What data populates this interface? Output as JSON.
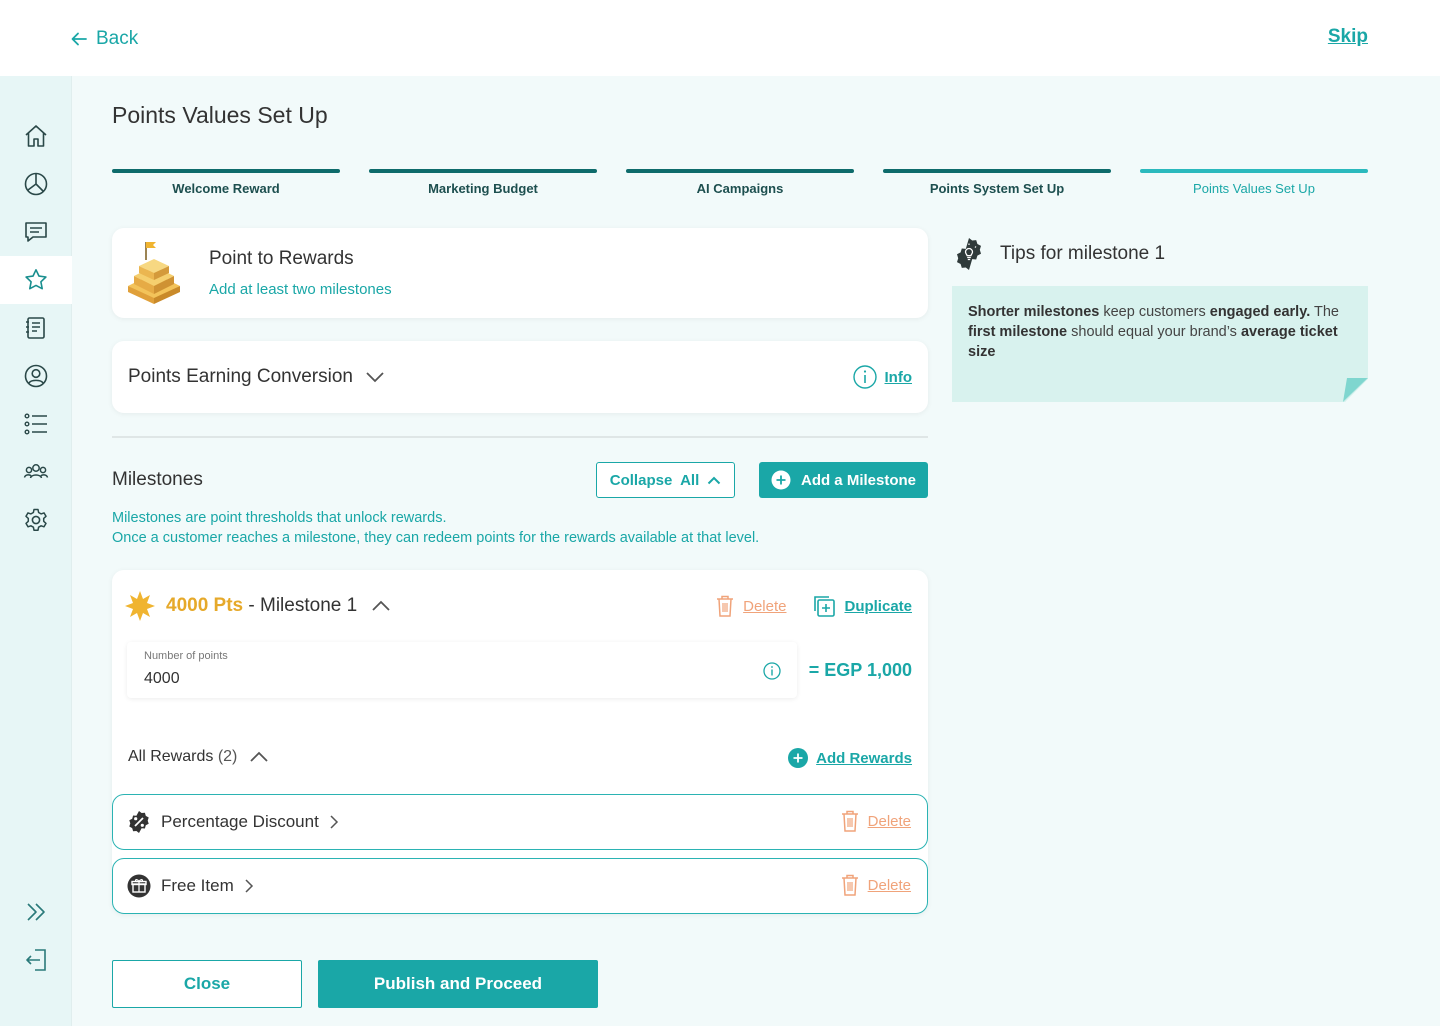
{
  "header": {
    "back_label": "Back",
    "skip_label": "Skip"
  },
  "sidebar": {
    "items": [
      {
        "icon": "home-icon"
      },
      {
        "icon": "chart-pie-icon"
      },
      {
        "icon": "chat-icon"
      },
      {
        "icon": "star-icon",
        "active": true
      },
      {
        "icon": "notebook-icon"
      },
      {
        "icon": "user-circle-icon"
      },
      {
        "icon": "list-icon"
      },
      {
        "icon": "group-icon"
      },
      {
        "icon": "gear-icon"
      }
    ],
    "bottom": [
      {
        "icon": "expand-icon"
      },
      {
        "icon": "logout-icon"
      }
    ]
  },
  "page": {
    "title": "Points Values Set Up"
  },
  "steps": [
    {
      "label": "Welcome Reward"
    },
    {
      "label": "Marketing Budget"
    },
    {
      "label": "AI Campaigns"
    },
    {
      "label": "Points System Set Up"
    },
    {
      "label": "Points Values Set Up",
      "current": true
    }
  ],
  "point_to_rewards": {
    "title": "Point to Rewards",
    "subtitle": "Add at least two milestones"
  },
  "points_earning": {
    "title": "Points Earning Conversion",
    "info_label": "Info"
  },
  "milestones": {
    "heading": "Milestones",
    "collapse_label": "Collapse  All",
    "add_label": "Add a Milestone",
    "desc_line1": "Milestones are point thresholds that unlock rewards.",
    "desc_line2": "Once a customer reaches a milestone, they can redeem points for the rewards available at that level.",
    "items": [
      {
        "points_label": "4000 Pts",
        "name": " - Milestone 1",
        "delete_label": "Delete",
        "duplicate_label": "Duplicate",
        "field_label": "Number of points",
        "field_value": "4000",
        "conversion": "= EGP 1,000",
        "rewards_title": "All Rewards",
        "rewards_count": "(2)",
        "add_rewards_label": "Add Rewards",
        "rewards": [
          {
            "name": "Percentage Discount",
            "icon": "percent-badge-icon",
            "delete_label": "Delete"
          },
          {
            "name": "Free Item",
            "icon": "gift-icon",
            "delete_label": "Delete"
          }
        ]
      }
    ]
  },
  "tips": {
    "title": "Tips for milestone 1",
    "b1": "Shorter milestones",
    "t1": " keep customers ",
    "b2": "engaged early.",
    "t2": " The ",
    "b3": "first milestone",
    "t3": " should equal your brand’s ",
    "b4": "average ticket size"
  },
  "footer": {
    "close_label": "Close",
    "publish_label": "Publish and Proceed"
  },
  "colors": {
    "accent": "#1aa7a7",
    "dark_teal": "#0e6b6b",
    "gold": "#e6a92a",
    "delete": "#f0a37a",
    "tip_bg": "#d8f2ee"
  }
}
